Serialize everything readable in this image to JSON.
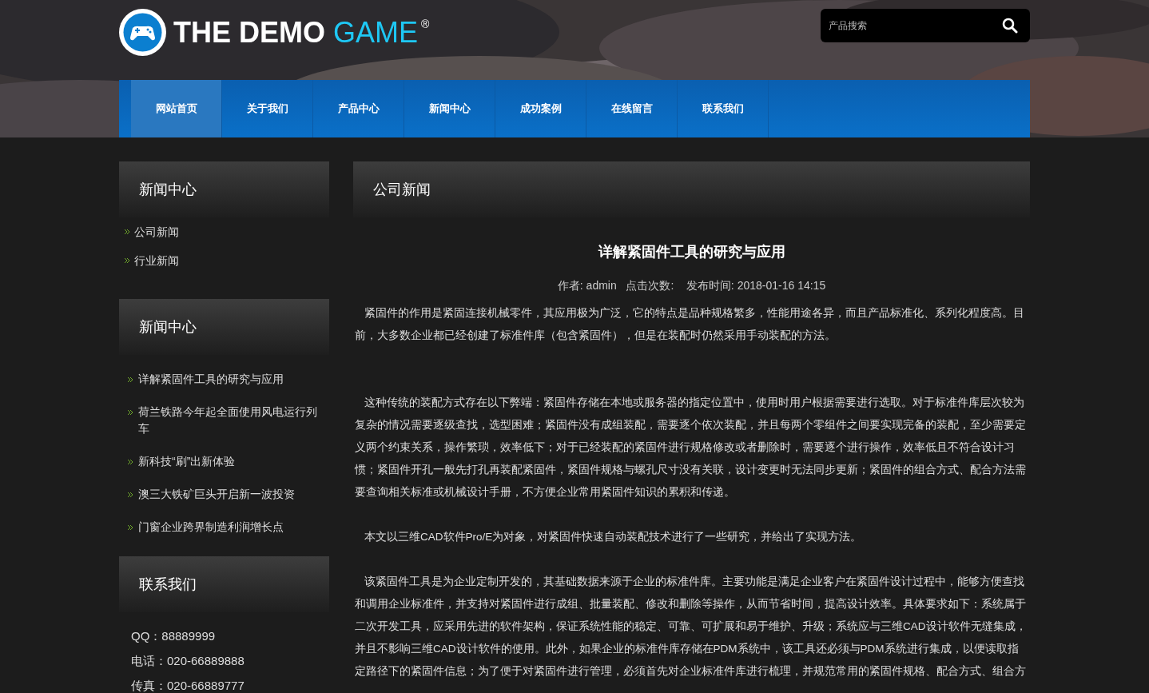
{
  "logo": {
    "text_main": "THE DEMO",
    "text_accent": "GAME",
    "mark": "®"
  },
  "search": {
    "placeholder": "产品搜索"
  },
  "nav": [
    {
      "label": "网站首页",
      "selected": true
    },
    {
      "label": "关于我们",
      "selected": false
    },
    {
      "label": "产品中心",
      "selected": false
    },
    {
      "label": "新闻中心",
      "selected": false
    },
    {
      "label": "成功案例",
      "selected": false
    },
    {
      "label": "在线留言",
      "selected": false
    },
    {
      "label": "联系我们",
      "selected": false
    }
  ],
  "sidebar": [
    {
      "kind": "links",
      "title": "新闻中心",
      "items": [
        "公司新闻",
        "行业新闻"
      ]
    },
    {
      "kind": "articles",
      "title": "新闻中心",
      "items": [
        "详解紧固件工具的研究与应用",
        "荷兰铁路今年起全面使用风电运行列车",
        "新科技“刷”出新体验",
        "澳三大铁矿巨头开启新一波投资",
        "门窗企业跨界制造利润增长点"
      ]
    },
    {
      "kind": "contact",
      "title": "联系我们",
      "items": [
        "QQ：88889999",
        "电话：020-66889888",
        "传真：020-66889777"
      ]
    }
  ],
  "content": {
    "title": "公司新闻",
    "article": {
      "headline": "详解紧固件工具的研究与应用",
      "meta": "作者: admin   点击次数:    发布时间: 2018-01-16 14:15",
      "paragraphs": [
        "紧固件的作用是紧固连接机械零件，其应用极为广泛，它的特点是品种规格繁多，性能用途各异，而且产品标准化、系列化程度高。目前，大多数企业都已经创建了标准件库（包含紧固件），但是在装配时仍然采用手动装配的方法。",
        "这种传统的装配方式存在以下弊端：紧固件存储在本地或服务器的指定位置中，使用时用户根据需要进行选取。对于标准件库层次较为复杂的情况需要逐级查找，选型困难；紧固件没有成组装配，需要逐个依次装配，并且每两个零组件之间要实现完备的装配，至少需要定义两个约束关系，操作繁琐，效率低下；对于已经装配的紧固件进行规格修改或者删除时，需要逐个进行操作，效率低且不符合设计习惯；紧固件开孔一般先打孔再装配紧固件，紧固件规格与螺孔尺寸没有关联，设计变更时无法同步更新；紧固件的组合方式、配合方法需要查询相关标准或机械设计手册，不方便企业常用紧固件知识的累积和传递。",
        "本文以三维CAD软件Pro/E为对象，对紧固件快速自动装配技术进行了一些研究，并给出了实现方法。",
        "该紧固件工具是为企业定制开发的，其基础数据来源于企业的标准件库。主要功能是满足企业客户在紧固件设计过程中，能够方便查找和调用企业标准件，并支持对紧固件进行成组、批量装配、修改和删除等操作，从而节省时间，提高设计效率。具体要求如下：系统属于二次开发工具，应采用先进的软件架构，保证系统性能的稳定、可靠、可扩展和易于维护、升级；系统应与三维CAD设计软件无缝集成，并且不影响三维CAD设计软件的使用。此外，如果企业的标准件库存储在PDM系统中，该工具还必须与PDM系统进行集成，以便读取指定路径下的紧固件信息；为了便于对紧固件进行管理，必须首先对企业标准件库进行梳理，并规范常用的紧固件规格、配合方式、组合方"
      ]
    }
  }
}
